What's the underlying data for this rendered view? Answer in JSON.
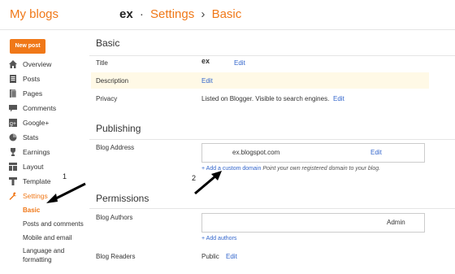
{
  "header": {
    "brand": "My blogs",
    "blog_name": "ex",
    "separator1": "·",
    "section": "Settings",
    "separator2": "›",
    "page": "Basic"
  },
  "sidebar": {
    "new_post": "New post",
    "items": [
      {
        "label": "Overview",
        "icon": "home-icon"
      },
      {
        "label": "Posts",
        "icon": "posts-icon"
      },
      {
        "label": "Pages",
        "icon": "pages-icon"
      },
      {
        "label": "Comments",
        "icon": "comment-icon"
      },
      {
        "label": "Google+",
        "icon": "google-plus-icon"
      },
      {
        "label": "Stats",
        "icon": "pie-chart-icon"
      },
      {
        "label": "Earnings",
        "icon": "trophy-icon"
      },
      {
        "label": "Layout",
        "icon": "layout-icon"
      },
      {
        "label": "Template",
        "icon": "template-icon"
      },
      {
        "label": "Settings",
        "icon": "wrench-icon"
      }
    ],
    "sub_items": [
      "Basic",
      "Posts and comments",
      "Mobile and email",
      "Language and formatting"
    ]
  },
  "basic": {
    "title": "Basic",
    "title_label": "Title",
    "title_value": "ex",
    "title_edit": "Edit",
    "description_label": "Description",
    "description_edit": "Edit",
    "privacy_label": "Privacy",
    "privacy_value": "Listed on Blogger. Visible to search engines.",
    "privacy_edit": "Edit"
  },
  "publishing": {
    "title": "Publishing",
    "address_label": "Blog Address",
    "address_value": "ex.blogspot.com",
    "address_edit": "Edit",
    "add_domain": "+ Add a custom domain",
    "domain_hint": "Point your own registered domain to your blog."
  },
  "permissions": {
    "title": "Permissions",
    "authors_label": "Blog Authors",
    "authors_role": "Admin",
    "add_authors": "+ Add authors",
    "readers_label": "Blog Readers",
    "readers_value": "Public",
    "readers_edit": "Edit"
  },
  "annotations": {
    "num1": "1",
    "num2": "2"
  },
  "colors": {
    "accent": "#f07818",
    "link": "#3366cc",
    "highlight": "#fff9e6"
  }
}
